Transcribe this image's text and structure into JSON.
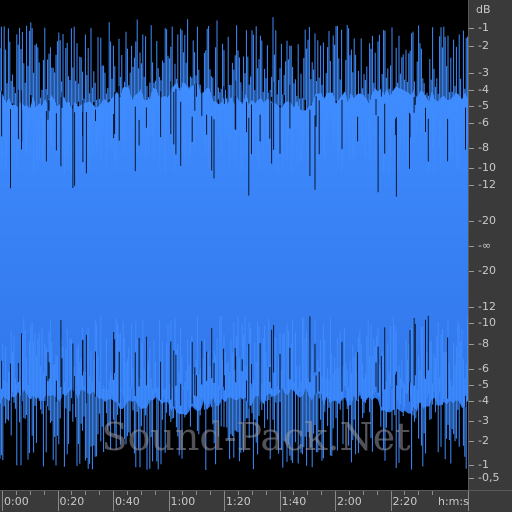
{
  "waveform": {
    "fill_color_top": "#3f8cff",
    "fill_color_bottom": "#2f75e8",
    "background": "#000000"
  },
  "db_scale": {
    "unit_label": "dB",
    "ticks": [
      "-1",
      "-2",
      "-3",
      "-4",
      "-5",
      "-6",
      "-8",
      "-10",
      "-12",
      "-20",
      "-∞",
      "-20",
      "-12",
      "-10",
      "-8",
      "-6",
      "-5",
      "-4",
      "-3",
      "-2",
      "-1",
      "-0,5"
    ]
  },
  "time_scale": {
    "ticks": [
      "0:00",
      "0:20",
      "0:40",
      "1:00",
      "1:20",
      "1:40",
      "2:00",
      "2:20"
    ],
    "unit_label": "h:m:s"
  },
  "watermark": {
    "text": "Sound-Pack.Net"
  }
}
